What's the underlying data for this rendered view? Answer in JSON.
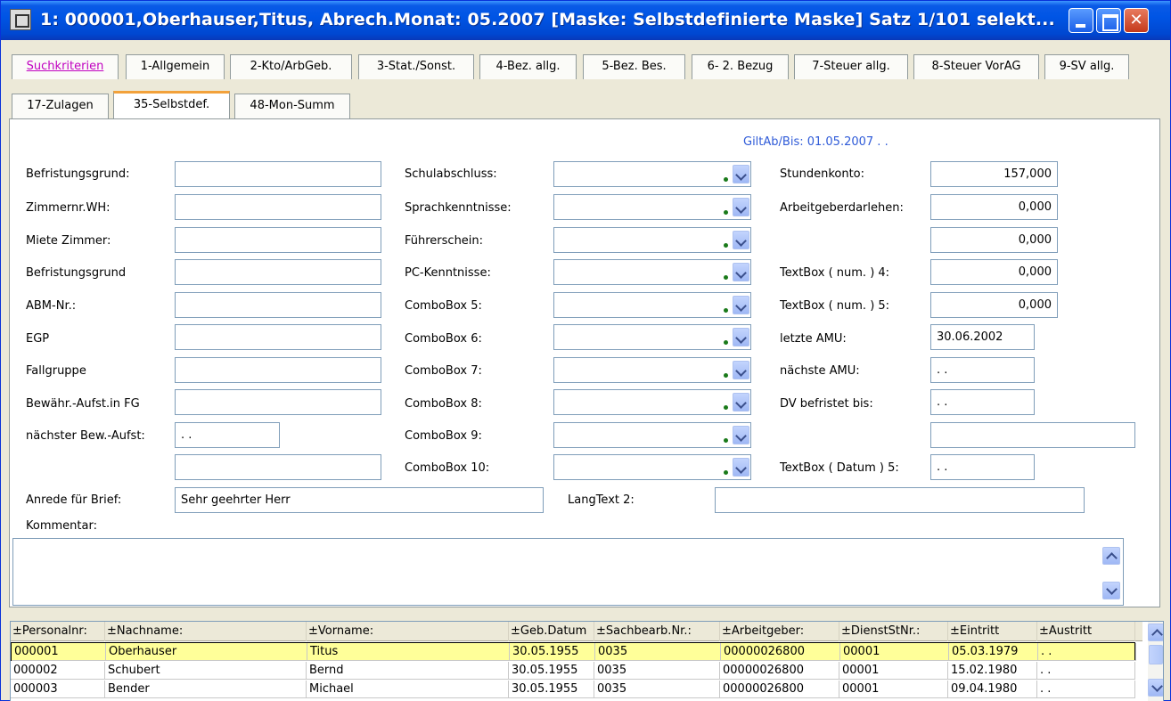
{
  "window": {
    "title": "1: 000001,Oberhauser,Titus, Abrech.Monat: 05.2007   [Maske: Selbstdefinierte Maske]   Satz 1/101 selekt..."
  },
  "tabs": {
    "row1": [
      "Suchkriterien",
      "1-Allgemein",
      "2-Kto/ArbGeb.",
      "3-Stat./Sonst.",
      "4-Bez. allg.",
      "5-Bez. Bes.",
      "6- 2. Bezug",
      "7-Steuer allg.",
      "8-Steuer VorAG",
      "9-SV allg."
    ],
    "row2": [
      "17-Zulagen",
      "35-Selbstdef.",
      "48-Mon-Summ"
    ],
    "active": "35-Selbstdef."
  },
  "gilt": "GiltAb/Bis:  01.05.2007        .  .",
  "left": {
    "labels": [
      "Befristungsgrund:",
      "Zimmernr.WH:",
      "Miete Zimmer:",
      "Befristungsgrund",
      "ABM-Nr.:",
      "EGP",
      "Fallgruppe",
      "Bewähr.-Aufst.in FG",
      "nächster Bew.-Aufst:"
    ],
    "values": [
      "",
      "",
      "",
      "",
      "",
      "",
      "",
      "",
      " .  .",
      ""
    ]
  },
  "middle": {
    "labels": [
      "Schulabschluss:",
      "Sprachkenntnisse:",
      "Führerschein:",
      "PC-Kenntnisse:",
      "ComboBox 5:",
      "ComboBox 6:",
      "ComboBox 7:",
      "ComboBox 8:",
      "ComboBox 9:",
      "ComboBox 10:"
    ]
  },
  "right": {
    "labels": [
      "Stundenkonto:",
      "Arbeitgeberdarlehen:",
      "",
      "TextBox ( num. ) 4:",
      "TextBox ( num. ) 5:",
      "letzte AMU:",
      "nächste AMU:",
      "DV befristet bis:",
      "",
      "TextBox ( Datum ) 5:"
    ],
    "values": [
      "157,000",
      "0,000",
      "0,000",
      "0,000",
      "0,000",
      "30.06.2002",
      " .  .",
      " .  .",
      "",
      " .  ."
    ]
  },
  "bottom": {
    "anrede_label": "Anrede für Brief:",
    "anrede_value": "Sehr geehrter Herr",
    "langtext_label": "LangText 2:",
    "langtext_value": "",
    "kommentar_label": "Kommentar:"
  },
  "grid": {
    "columns": [
      "±Personalnr:",
      "±Nachname:",
      "±Vorname:",
      "±Geb.Datum",
      "±Sachbearb.Nr.:",
      "±Arbeitgeber:",
      "±DienstStNr.:",
      "±Eintritt",
      "±Austritt"
    ],
    "rows": [
      [
        "000001",
        "Oberhauser",
        "Titus",
        "30.05.1955",
        "0035",
        "00000026800",
        "00001",
        "05.03.1979",
        " .  ."
      ],
      [
        "000002",
        "Schubert",
        "Bernd",
        "30.05.1955",
        "0035",
        "00000026800",
        "00001",
        "15.02.1980",
        " .  ."
      ],
      [
        "000003",
        "Bender",
        "Michael",
        "30.05.1955",
        "0035",
        "00000026800",
        "00001",
        "09.04.1980",
        " .  ."
      ]
    ]
  },
  "colors": {
    "titlebar": "#0055e5",
    "tab_active_accent": "#f2a13a",
    "selected_row": "#ffff99",
    "gilt_text": "#2f5bd8"
  }
}
